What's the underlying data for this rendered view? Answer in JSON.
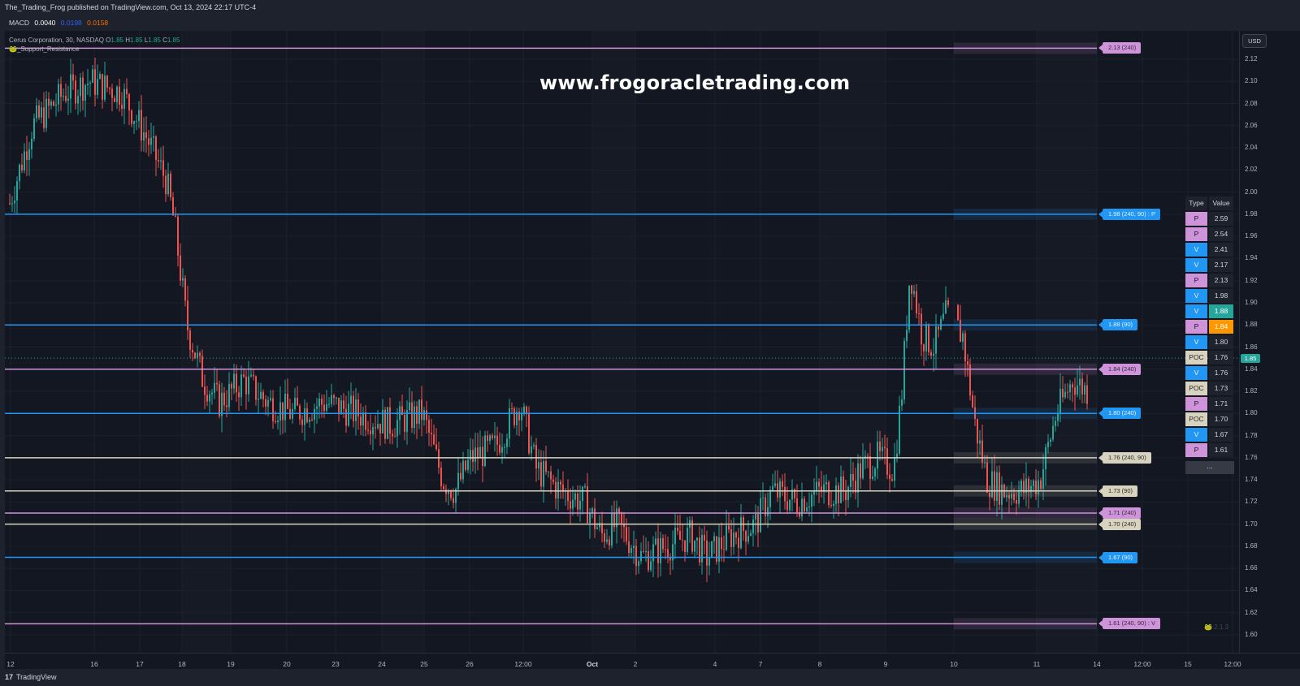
{
  "header": {
    "publish_text": "The_Trading_Frog published on TradingView.com, Oct 13, 2024 22:17 UTC-4"
  },
  "macd": {
    "label": "MACD",
    "v1": "0.0040",
    "v2": "0.0198",
    "v3": "0.0158",
    "c1": "#ffffff",
    "c2": "#2962ff",
    "c3": "#ff6d00"
  },
  "legend": {
    "symbol": "Cerus Corporation, 30, NASDAQ",
    "o_label": "O",
    "o": "1.85",
    "h_label": "H",
    "h": "1.85",
    "l_label": "L",
    "l": "1.85",
    "c_label": "C",
    "c": "1.85",
    "indicator": "🐸_Support_Resistance"
  },
  "watermark": "www.frogoracletrading.com",
  "currency_button": "USD",
  "current_price": "1.85",
  "price_axis_ticks": [
    "2.12",
    "2.10",
    "2.08",
    "2.06",
    "2.04",
    "2.02",
    "2.00",
    "1.98",
    "1.96",
    "1.94",
    "1.92",
    "1.90",
    "1.88",
    "1.86",
    "1.84",
    "1.82",
    "1.80",
    "1.78",
    "1.76",
    "1.74",
    "1.72",
    "1.70",
    "1.68",
    "1.66",
    "1.64",
    "1.62",
    "1.60"
  ],
  "time_axis_ticks": [
    "12",
    "16",
    "17",
    "18",
    "19",
    "20",
    "23",
    "24",
    "25",
    "26",
    "12:00",
    "Oct",
    "2",
    "4",
    "7",
    "8",
    "9",
    "10",
    "11",
    "14",
    "12:00",
    "15",
    "12:00"
  ],
  "levels": [
    {
      "price": 2.13,
      "label": "2.13 (240)",
      "kind": "purple"
    },
    {
      "price": 1.98,
      "label": "1.98 (240, 90) : P",
      "kind": "blue"
    },
    {
      "price": 1.88,
      "label": "1.88 (90)",
      "kind": "blue"
    },
    {
      "price": 1.84,
      "label": "1.84 (240)",
      "kind": "purple"
    },
    {
      "price": 1.8,
      "label": "1.80 (240)",
      "kind": "blue"
    },
    {
      "price": 1.76,
      "label": "1.76 (240, 90)",
      "kind": "beige"
    },
    {
      "price": 1.73,
      "label": "1.73 (90)",
      "kind": "beige"
    },
    {
      "price": 1.71,
      "label": "1.71 (240)",
      "kind": "purple"
    },
    {
      "price": 1.7,
      "label": "1.70 (240)",
      "kind": "beige"
    },
    {
      "price": 1.67,
      "label": "1.67 (90)",
      "kind": "blue"
    },
    {
      "price": 1.61,
      "label": "1.61 (240, 90) : V",
      "kind": "purple"
    }
  ],
  "table": {
    "headers": [
      "Type",
      "Value"
    ],
    "rows": [
      {
        "type": "P",
        "value": "2.59"
      },
      {
        "type": "P",
        "value": "2.54"
      },
      {
        "type": "V",
        "value": "2.41"
      },
      {
        "type": "V",
        "value": "2.17"
      },
      {
        "type": "P",
        "value": "2.13"
      },
      {
        "type": "V",
        "value": "1.98"
      },
      {
        "type": "V",
        "value": "1.88",
        "highlight": "#26a69a"
      },
      {
        "type": "P",
        "value": "1.84",
        "highlight": "#ff9800"
      },
      {
        "type": "V",
        "value": "1.80"
      },
      {
        "type": "POC",
        "value": "1.76"
      },
      {
        "type": "V",
        "value": "1.76"
      },
      {
        "type": "POC",
        "value": "1.73"
      },
      {
        "type": "P",
        "value": "1.71"
      },
      {
        "type": "POC",
        "value": "1.70"
      },
      {
        "type": "V",
        "value": "1.67"
      },
      {
        "type": "P",
        "value": "1.61"
      }
    ],
    "more_label": "..."
  },
  "version_label": "2.1.3",
  "footer": {
    "brand": "TradingView"
  },
  "colors": {
    "up": "#26a69a",
    "down": "#ef5350",
    "blue": "#2196f3",
    "purple": "#ce93d8",
    "beige": "#d7d3bf"
  }
}
